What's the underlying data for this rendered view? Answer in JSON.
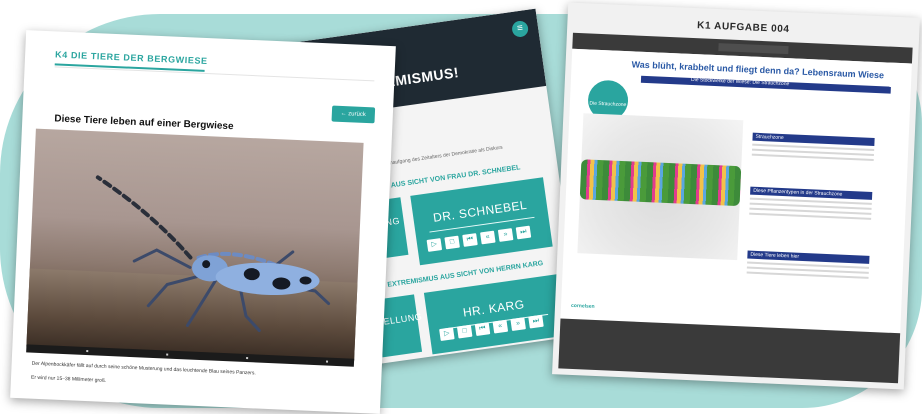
{
  "left_card": {
    "section_title": "K4 DIE TIERE DER BERGWIESE",
    "back_button": "← zurück",
    "heading": "Diese Tiere leben auf einer Bergwiese",
    "caption_1": "Der Alpenbockkäfer fällt auf durch seine schöne Musterung und das leuchtende Blau seines Panzers.",
    "caption_2": "Er wird nur 15–38 Millimeter groß."
  },
  "middle_card": {
    "title": "EXTREMISMUS!",
    "intro": "Sonnenaufgang des Zeitalters der Demokratie als Diskurs",
    "section_1": "MUS AUS SICHT VON FRAU DR. SCHNEBEL",
    "section_2": "EXTREMISMUS AUS SICHT VON HERRN KARG",
    "tile_1_left": "LLUNG",
    "tile_1_name": "DR. SCHNEBEL",
    "tile_2_left": "TELLUNG",
    "tile_2_name": "HR. KARG",
    "controls": [
      "▷",
      "□",
      "⏮",
      "«",
      "»",
      "⏭"
    ]
  },
  "right_card": {
    "title": "K1 AUFGABE 004",
    "page_title": "Was blüht, krabbelt und fliegt denn da? Lebensraum Wiese",
    "band": "Die Stockwerke der Wiese: Die Strauchzone",
    "badge": "Die Strauchzone",
    "box_1": "Strauchzone",
    "box_2": "Diese Pflanzentypen in der Strauchzone",
    "box_3": "Diese Tiere leben hier",
    "logo": "cornelsen"
  }
}
